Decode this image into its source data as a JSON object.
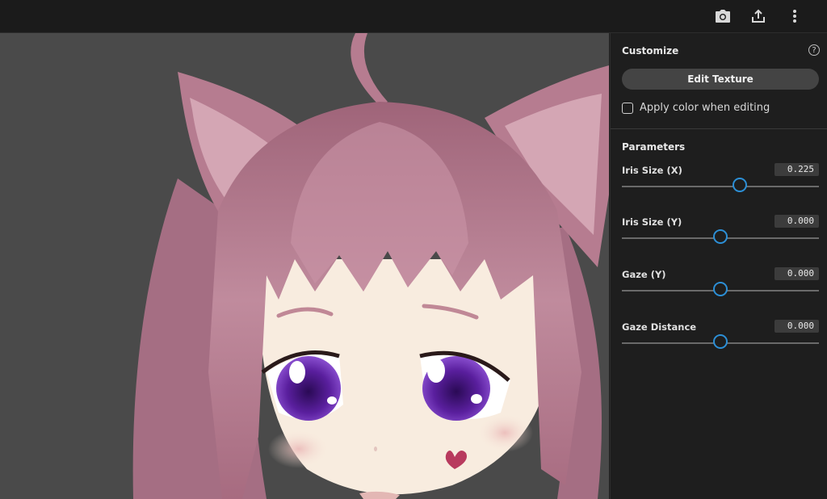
{
  "toolbar": {
    "icons": [
      "camera-icon",
      "share-icon",
      "more-vertical-icon"
    ]
  },
  "panel": {
    "customize": {
      "title": "Customize",
      "help_glyph": "?",
      "edit_texture_label": "Edit Texture",
      "apply_color_label": "Apply color when editing",
      "apply_color_checked": false
    },
    "parameters": {
      "title": "Parameters",
      "items": [
        {
          "label": "Iris Size (X)",
          "value": "0.225",
          "fraction": 0.6
        },
        {
          "label": "Iris Size (Y)",
          "value": "0.000",
          "fraction": 0.5
        },
        {
          "label": "Gaze (Y)",
          "value": "0.000",
          "fraction": 0.5
        },
        {
          "label": "Gaze Distance",
          "value": "0.000",
          "fraction": 0.5
        }
      ]
    }
  },
  "colors": {
    "accent": "#2c8fd6",
    "viewport_bg": "#4a4a4a",
    "hair": "#b97f92",
    "skin": "#f8ecdf",
    "iris": "#5a1f9e"
  }
}
